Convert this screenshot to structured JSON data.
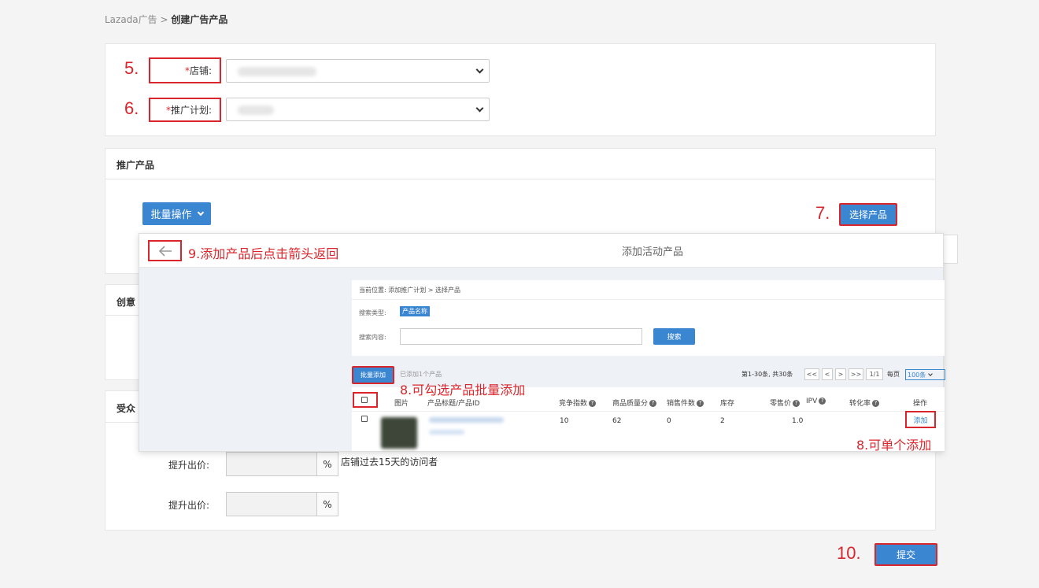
{
  "breadcrumb": {
    "root": "Lazada广告",
    "sep": " > ",
    "current": "创建广告产品"
  },
  "form": {
    "store": {
      "num": "5.",
      "required": "*",
      "label": "店铺:"
    },
    "plan": {
      "num": "6.",
      "required": "*",
      "label": "推广计划:"
    }
  },
  "promo": {
    "title": "推广产品",
    "batch_op": "批量操作",
    "select_num": "7.",
    "select_btn": "选择产品"
  },
  "creative": {
    "title": "创意"
  },
  "audience": {
    "title": "受众",
    "raise1_label": "提升出价:",
    "raise2_label": "提升出价:",
    "pct": "%",
    "visitor_desc": "店铺过去15天的访问者"
  },
  "submit": {
    "num": "10.",
    "label": "提交"
  },
  "modal": {
    "title": "添加活动产品",
    "back_note": "9.添加产品后点击箭头返回",
    "location": "当前位置: 添加推广计划 > 选择产品",
    "search_type_label": "搜索类型:",
    "search_type_value": "产品名称",
    "search_content_label": "搜索内容:",
    "search_btn": "搜索",
    "batch_add": "批量添加",
    "added_info": "已添加1个产品",
    "batch_note": "8.可勾选产品批量添加",
    "single_note": "8.可单个添加",
    "pagination": {
      "info": "第1-30条, 共30条",
      "first": "<<",
      "prev": "<",
      "next": ">",
      "last": ">>",
      "page": "1/1",
      "per_page_label": "每页",
      "per_page_value": "100条"
    },
    "columns": [
      "图片",
      "产品标题/产品ID",
      "竞争指数",
      "商品质量分",
      "销售件数",
      "库存",
      "零售价",
      "IPV",
      "转化率",
      "操作"
    ],
    "row": {
      "competition": "10",
      "quality": "62",
      "sales": "0",
      "stock": "2",
      "price": "1.0",
      "action": "添加"
    }
  }
}
